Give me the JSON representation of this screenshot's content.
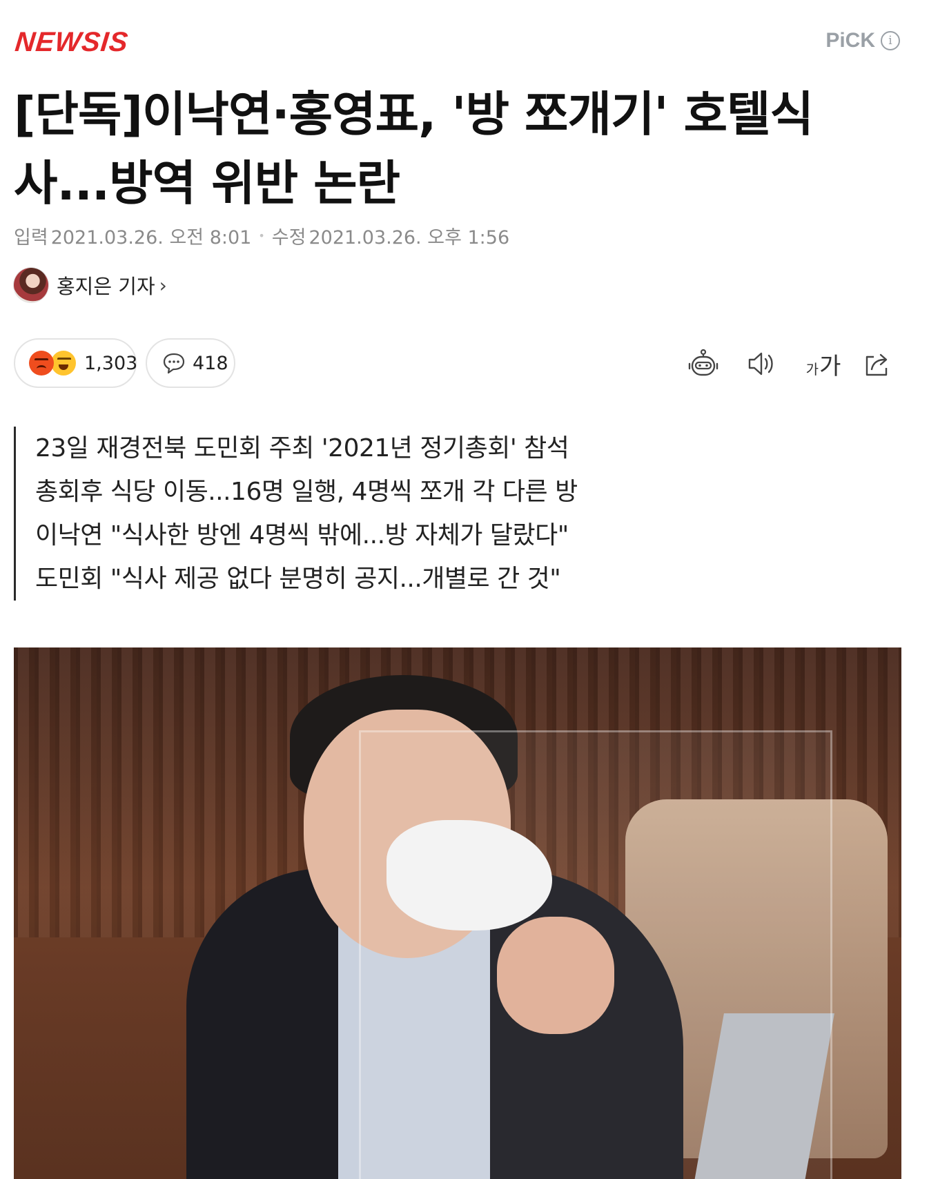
{
  "header": {
    "logo_text": "NEWSIS",
    "pick_label": "PiCK",
    "info_glyph": "i"
  },
  "article": {
    "headline_line1": "[단독]이낙연·홍영표, '방 쪼개기' 호텔식",
    "headline_line2": "사...방역 위반 논란",
    "input_label": "입력",
    "input_date": "2021.03.26. 오전 8:01",
    "modified_label": "수정",
    "modified_date": "2021.03.26. 오후 1:56",
    "reporter": "홍지은 기자",
    "reporter_chevron": "›"
  },
  "actions": {
    "reactions_count": "1,303",
    "comments_count": "418",
    "font_small": "가",
    "font_large": "가"
  },
  "summary": [
    "23일 재경전북 도민회 주최 '2021년 정기총회' 참석",
    "총회후 식당 이동...16명 일행, 4명씩 쪼개 각 다른 방",
    "이낙연 \"식사한 방엔 4명씩 밖에...방 자체가 달랐다\"",
    "도민회 \"식사 제공 없다 분명히 공지...개별로 간 것\""
  ],
  "colors": {
    "brand_red": "#e4282b",
    "muted_gray": "#9aa0a6"
  },
  "icons": [
    "robot-summary-icon",
    "speaker-icon",
    "font-size-icon",
    "share-icon",
    "comment-bubble-icon",
    "info-icon"
  ]
}
